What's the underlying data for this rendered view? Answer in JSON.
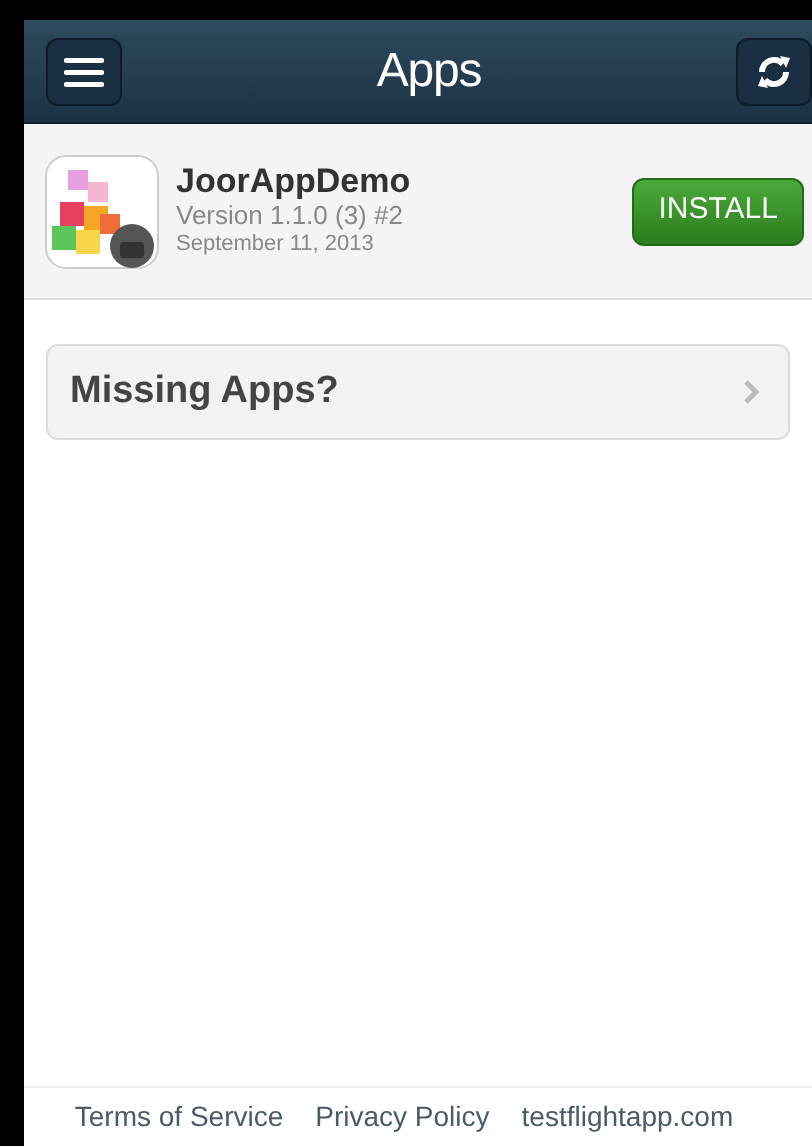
{
  "header": {
    "title": "Apps"
  },
  "apps": [
    {
      "name": "JoorAppDemo",
      "version": "Version 1.1.0 (3) #2",
      "date": "September 11, 2013",
      "action": "INSTALL"
    }
  ],
  "missing_apps": {
    "label": "Missing Apps?"
  },
  "footer": {
    "links": [
      "Terms of Service",
      "Privacy Policy",
      "testflightapp.com"
    ]
  }
}
